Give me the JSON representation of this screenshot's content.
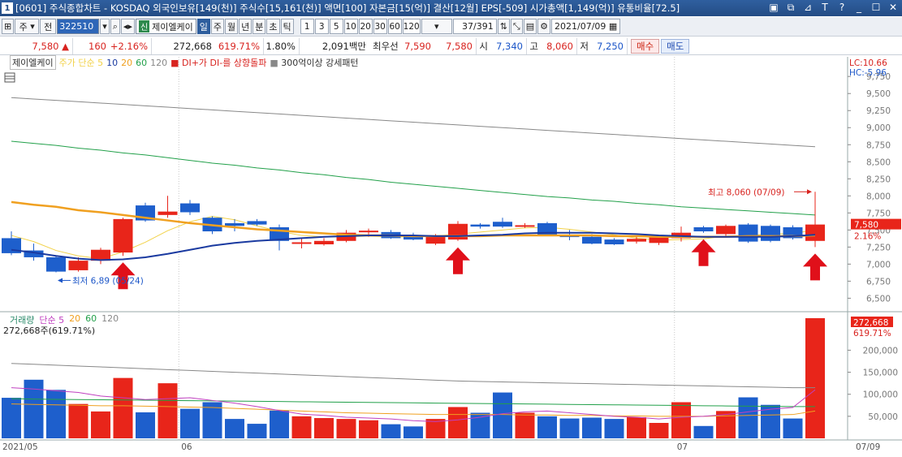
{
  "window": {
    "number": "1",
    "title": "[0601] 주식종합차트 - KOSDAQ 외국인보유[149(천)] 주식수[15,161(천)] 액면[100] 자본금[15(억)] 결산[12월] EPS[-509] 시가총액[1,149(억)] 유통비율[72.5]",
    "buttons": [
      "▣",
      "⧉",
      "⊿",
      "T",
      "?",
      "_",
      "☐",
      "✕"
    ]
  },
  "toolbar": {
    "market": "주",
    "scope": "전",
    "code": "322510",
    "new_badge": "신",
    "stock_name": "제이엘케이",
    "periods": [
      "일",
      "주",
      "월",
      "년",
      "분",
      "초",
      "틱"
    ],
    "selected_period": "일",
    "intervals": [
      "1",
      "3",
      "5",
      "10",
      "20",
      "30",
      "60",
      "120"
    ],
    "counter": "37/391",
    "date": "2021/07/09"
  },
  "quote": {
    "price": "7,580",
    "change": "160",
    "change_pct": "+2.16%",
    "volume": "272,668",
    "volume_ratio": "619.71%",
    "turnover": "1.80%",
    "amount": "2,091백만",
    "best_ask_label": "최우선",
    "best_ask": "7,590",
    "best_bid": "7,580",
    "open_label": "시",
    "open": "7,340",
    "high_label": "고",
    "high": "8,060",
    "low_label": "저",
    "low": "7,250",
    "buy": "매수",
    "sell": "매도"
  },
  "legend": {
    "name": "제이엘케이",
    "ma_label": "주가 단순 5",
    "ma": [
      "10",
      "20",
      "60",
      "120"
    ],
    "signal1": "DI+가 DI-를 상향돌파",
    "signal2": "300억이상 강세패턴",
    "lc": "LC:10.66",
    "hc": "HC:-5.96"
  },
  "annotations": {
    "high_label": "최고 8,060 (07/09)",
    "low_label": "최저 6,89 (05/24)",
    "price_tag": "7,580",
    "pct_tag": "2.16%",
    "vol_tag": "272,668",
    "vol_pct_tag": "619.71%"
  },
  "volume_legend": {
    "name": "거래량",
    "ma_label": "단순 5",
    "ma": [
      "20",
      "60",
      "120"
    ],
    "current": "272,668주(619.71%)"
  },
  "x_labels": [
    "2021/05",
    "06",
    "07",
    "07/09"
  ],
  "colors": {
    "up": "#e8251a",
    "down": "#1e5fcc",
    "ma5": "#f2d24a",
    "ma10": "#1a3aa0",
    "ma20": "#f0a020",
    "ma60": "#22a04a",
    "ma120": "#888888",
    "vol5": "#c040c0"
  },
  "chart_data": {
    "type": "candlestick",
    "y_ticks": [
      6500,
      6750,
      7000,
      7250,
      7500,
      7750,
      8000,
      8250,
      8500,
      8750,
      9000,
      9250,
      9500,
      9750
    ],
    "y_tick_labels": [
      "6,500",
      "6,750",
      "7,000",
      "7,250",
      "7,500",
      "7,750",
      "8,000",
      "8,250",
      "8,500",
      "8,750",
      "9,000",
      "9,250",
      "9,500",
      "9,750"
    ],
    "vol_ticks": [
      50000,
      100000,
      150000,
      200000
    ],
    "vol_tick_labels": [
      "50,000",
      "100,000",
      "150,000",
      "200,000"
    ],
    "ylim": [
      6350,
      9800
    ],
    "vol_max": 280000,
    "candles": [
      {
        "o": 7380,
        "h": 7480,
        "l": 7130,
        "c": 7160,
        "v": 92000
      },
      {
        "o": 7200,
        "h": 7300,
        "l": 7050,
        "c": 7100,
        "v": 133000
      },
      {
        "o": 7100,
        "h": 7130,
        "l": 6880,
        "c": 6890,
        "v": 110000
      },
      {
        "o": 6910,
        "h": 7100,
        "l": 6890,
        "c": 7050,
        "v": 78000
      },
      {
        "o": 7050,
        "h": 7240,
        "l": 7000,
        "c": 7210,
        "v": 61000
      },
      {
        "o": 7170,
        "h": 7680,
        "l": 7120,
        "c": 7660,
        "v": 137000
      },
      {
        "o": 7860,
        "h": 7900,
        "l": 7620,
        "c": 7640,
        "v": 59000
      },
      {
        "o": 7720,
        "h": 8000,
        "l": 7680,
        "c": 7770,
        "v": 125000
      },
      {
        "o": 7890,
        "h": 7940,
        "l": 7720,
        "c": 7760,
        "v": 67000
      },
      {
        "o": 7680,
        "h": 7700,
        "l": 7440,
        "c": 7480,
        "v": 82000
      },
      {
        "o": 7600,
        "h": 7660,
        "l": 7480,
        "c": 7560,
        "v": 44000
      },
      {
        "o": 7630,
        "h": 7660,
        "l": 7560,
        "c": 7580,
        "v": 33000
      },
      {
        "o": 7540,
        "h": 7580,
        "l": 7200,
        "c": 7340,
        "v": 63000
      },
      {
        "o": 7310,
        "h": 7380,
        "l": 7230,
        "c": 7320,
        "v": 50000
      },
      {
        "o": 7290,
        "h": 7380,
        "l": 7270,
        "c": 7340,
        "v": 46000
      },
      {
        "o": 7340,
        "h": 7500,
        "l": 7320,
        "c": 7460,
        "v": 44000
      },
      {
        "o": 7470,
        "h": 7520,
        "l": 7400,
        "c": 7490,
        "v": 41000
      },
      {
        "o": 7470,
        "h": 7500,
        "l": 7370,
        "c": 7380,
        "v": 32000
      },
      {
        "o": 7420,
        "h": 7460,
        "l": 7350,
        "c": 7360,
        "v": 27000
      },
      {
        "o": 7300,
        "h": 7440,
        "l": 7280,
        "c": 7420,
        "v": 44000
      },
      {
        "o": 7360,
        "h": 7630,
        "l": 7340,
        "c": 7590,
        "v": 71000
      },
      {
        "o": 7580,
        "h": 7600,
        "l": 7520,
        "c": 7550,
        "v": 58000
      },
      {
        "o": 7620,
        "h": 7680,
        "l": 7530,
        "c": 7550,
        "v": 104000
      },
      {
        "o": 7560,
        "h": 7600,
        "l": 7530,
        "c": 7570,
        "v": 58000
      },
      {
        "o": 7600,
        "h": 7620,
        "l": 7420,
        "c": 7420,
        "v": 50000
      },
      {
        "o": 7420,
        "h": 7500,
        "l": 7350,
        "c": 7400,
        "v": 45000
      },
      {
        "o": 7400,
        "h": 7440,
        "l": 7290,
        "c": 7300,
        "v": 47000
      },
      {
        "o": 7360,
        "h": 7380,
        "l": 7280,
        "c": 7290,
        "v": 44000
      },
      {
        "o": 7330,
        "h": 7400,
        "l": 7300,
        "c": 7370,
        "v": 48000
      },
      {
        "o": 7310,
        "h": 7420,
        "l": 7280,
        "c": 7390,
        "v": 35000
      },
      {
        "o": 7380,
        "h": 7550,
        "l": 7330,
        "c": 7460,
        "v": 82000
      },
      {
        "o": 7540,
        "h": 7560,
        "l": 7460,
        "c": 7480,
        "v": 28000
      },
      {
        "o": 7440,
        "h": 7580,
        "l": 7410,
        "c": 7560,
        "v": 62000
      },
      {
        "o": 7580,
        "h": 7600,
        "l": 7310,
        "c": 7330,
        "v": 93000
      },
      {
        "o": 7560,
        "h": 7580,
        "l": 7320,
        "c": 7340,
        "v": 76000
      },
      {
        "o": 7540,
        "h": 7570,
        "l": 7360,
        "c": 7380,
        "v": 45000
      },
      {
        "o": 7340,
        "h": 8060,
        "l": 7250,
        "c": 7580,
        "v": 272668
      }
    ],
    "ma5": [
      7420,
      7330,
      7200,
      7120,
      7080,
      7180,
      7320,
      7490,
      7620,
      7700,
      7650,
      7560,
      7480,
      7420,
      7400,
      7400,
      7410,
      7400,
      7400,
      7410,
      7440,
      7470,
      7500,
      7530,
      7540,
      7510,
      7470,
      7430,
      7380,
      7350,
      7360,
      7370,
      7410,
      7420,
      7440,
      7450,
      7500
    ],
    "ma10": [
      7210,
      7170,
      7120,
      7080,
      7060,
      7070,
      7100,
      7150,
      7210,
      7270,
      7310,
      7340,
      7360,
      7380,
      7400,
      7410,
      7420,
      7420,
      7420,
      7410,
      7410,
      7420,
      7430,
      7450,
      7460,
      7460,
      7460,
      7450,
      7440,
      7420,
      7410,
      7400,
      7400,
      7400,
      7400,
      7410,
      7430
    ],
    "ma20": [
      7910,
      7870,
      7840,
      7790,
      7760,
      7720,
      7680,
      7640,
      7600,
      7570,
      7540,
      7510,
      7490,
      7470,
      7450,
      7430,
      7420,
      7420,
      7410,
      7410,
      7410,
      7410,
      7420,
      7420,
      7420,
      7420,
      7420,
      7410,
      7410,
      7400,
      7400,
      7400,
      7400,
      7410,
      7410,
      7410,
      7420
    ],
    "ma60": [
      8800,
      8770,
      8740,
      8700,
      8670,
      8630,
      8600,
      8560,
      8520,
      8480,
      8450,
      8410,
      8380,
      8340,
      8310,
      8270,
      8240,
      8200,
      8170,
      8140,
      8110,
      8080,
      8050,
      8020,
      7990,
      7970,
      7940,
      7920,
      7890,
      7870,
      7840,
      7820,
      7800,
      7780,
      7760,
      7740,
      7720
    ],
    "ma120": [
      9440,
      9420,
      9400,
      9380,
      9360,
      9340,
      9320,
      9300,
      9280,
      9260,
      9240,
      9220,
      9200,
      9180,
      9160,
      9140,
      9120,
      9100,
      9080,
      9060,
      9040,
      9020,
      9000,
      8980,
      8960,
      8940,
      8920,
      8900,
      8880,
      8860,
      8840,
      8820,
      8800,
      8780,
      8760,
      8740,
      8720
    ],
    "vol_ma5": [
      115000,
      112000,
      108000,
      104000,
      96000,
      92000,
      88000,
      90000,
      92000,
      86000,
      80000,
      72000,
      63000,
      55000,
      52000,
      48000,
      46000,
      44000,
      40000,
      38000,
      42000,
      48000,
      56000,
      60000,
      62000,
      58000,
      54000,
      50000,
      48000,
      44000,
      48000,
      50000,
      54000,
      60000,
      66000,
      70000,
      110000
    ],
    "vol_ma20": [
      78000,
      77000,
      76000,
      75000,
      74000,
      74000,
      73000,
      72000,
      71000,
      70000,
      68000,
      66000,
      64000,
      62000,
      60000,
      58000,
      57000,
      56000,
      55000,
      54000,
      54000,
      54000,
      54000,
      53000,
      53000,
      52000,
      52000,
      51000,
      51000,
      50000,
      50000,
      50000,
      51000,
      52000,
      53000,
      54000,
      62000
    ],
    "vol_ma60": [
      90000,
      89000,
      88500,
      88000,
      87500,
      87000,
      86500,
      86000,
      85500,
      85000,
      84500,
      84000,
      83500,
      83000,
      82500,
      82000,
      81500,
      81000,
      80500,
      80000,
      79500,
      79000,
      78500,
      78000,
      77500,
      77000,
      76500,
      76000,
      75500,
      75000,
      74500,
      74000,
      73500,
      73000,
      72500,
      72000,
      72000
    ],
    "vol_ma120": [
      170000,
      168000,
      166000,
      164000,
      162000,
      160000,
      158000,
      156000,
      154000,
      152000,
      150000,
      148000,
      146000,
      144000,
      142000,
      140000,
      138000,
      136000,
      134000,
      132000,
      130000,
      129000,
      128000,
      127000,
      126000,
      125000,
      124000,
      123000,
      122000,
      121000,
      120000,
      119000,
      118000,
      117000,
      116000,
      115000,
      115000
    ],
    "signal_indices": [
      5,
      20,
      31,
      36
    ],
    "high_index": 36,
    "low_index": 2
  }
}
